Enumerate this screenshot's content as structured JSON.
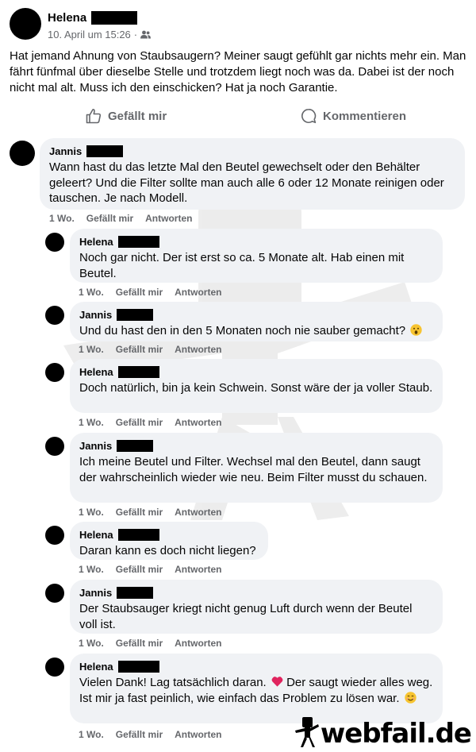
{
  "post": {
    "author": "Helena",
    "date": "10. April um 15:26",
    "audience_icon": "friends-icon",
    "text": "Hat jemand Ahnung von Staubsaugern? Meiner saugt gefühlt gar nichts mehr ein. Man fährt fünfmal über dieselbe Stelle und trotzdem liegt noch was da. Dabei ist der noch nicht mal alt. Muss ich den einschicken? Hat ja noch Garantie."
  },
  "actions": {
    "like": "Gefällt mir",
    "comment": "Kommentieren"
  },
  "comments": [
    {
      "name": "Jannis",
      "text": "Wann hast du das letzte Mal den Beutel gewechselt oder den Behälter geleert? Und die Filter sollte man auch alle 6 oder 12 Monate reinigen oder tauschen. Je nach Modell.",
      "time": "1 Wo.",
      "like": "Gefällt mir",
      "reply": "Antworten"
    },
    {
      "name": "Helena",
      "text": "Noch gar nicht. Der ist erst so ca. 5 Monate alt. Hab einen mit Beutel.",
      "time": "1 Wo.",
      "like": "Gefällt mir",
      "reply": "Antworten"
    },
    {
      "name": "Jannis",
      "text": "Und du hast den in den 5 Monaten noch nie sauber gemacht?",
      "emoji": "surprised-emoji",
      "time": "1 Wo.",
      "like": "Gefällt mir",
      "reply": "Antworten"
    },
    {
      "name": "Helena",
      "text": "Doch natürlich, bin ja kein Schwein. Sonst wäre der ja voller Staub.",
      "time": "1 Wo.",
      "like": "Gefällt mir",
      "reply": "Antworten"
    },
    {
      "name": "Jannis",
      "text": "Ich meine Beutel und Filter. Wechsel mal den Beutel, dann saugt der wahrscheinlich wieder wie neu. Beim Filter musst du schauen.",
      "time": "1 Wo.",
      "like": "Gefällt mir",
      "reply": "Antworten"
    },
    {
      "name": "Helena",
      "text": "Daran kann es doch nicht liegen?",
      "time": "1 Wo.",
      "like": "Gefällt mir",
      "reply": "Antworten"
    },
    {
      "name": "Jannis",
      "text": "Der Staubsauger kriegt nicht genug Luft durch wenn der Beutel voll ist.",
      "time": "1 Wo.",
      "like": "Gefällt mir",
      "reply": "Antworten"
    },
    {
      "name": "Helena",
      "text_a": "Vielen Dank! Lag tatsächlich daran.",
      "text_b": "Der saugt wieder alles weg. Ist mir ja fast peinlich, wie einfach das Problem zu lösen war.",
      "emoji_a": "red-heart-emoji",
      "emoji_b": "smiling-emoji",
      "time": "1 Wo.",
      "like": "Gefällt mir",
      "reply": "Antworten"
    }
  ],
  "watermark": {
    "icon": "webfail-mascot-icon",
    "logo_text": "webfail.de"
  },
  "colors": {
    "bubble": "#f0f2f5",
    "secondary_text": "#65676b",
    "redaction": "#000000"
  }
}
